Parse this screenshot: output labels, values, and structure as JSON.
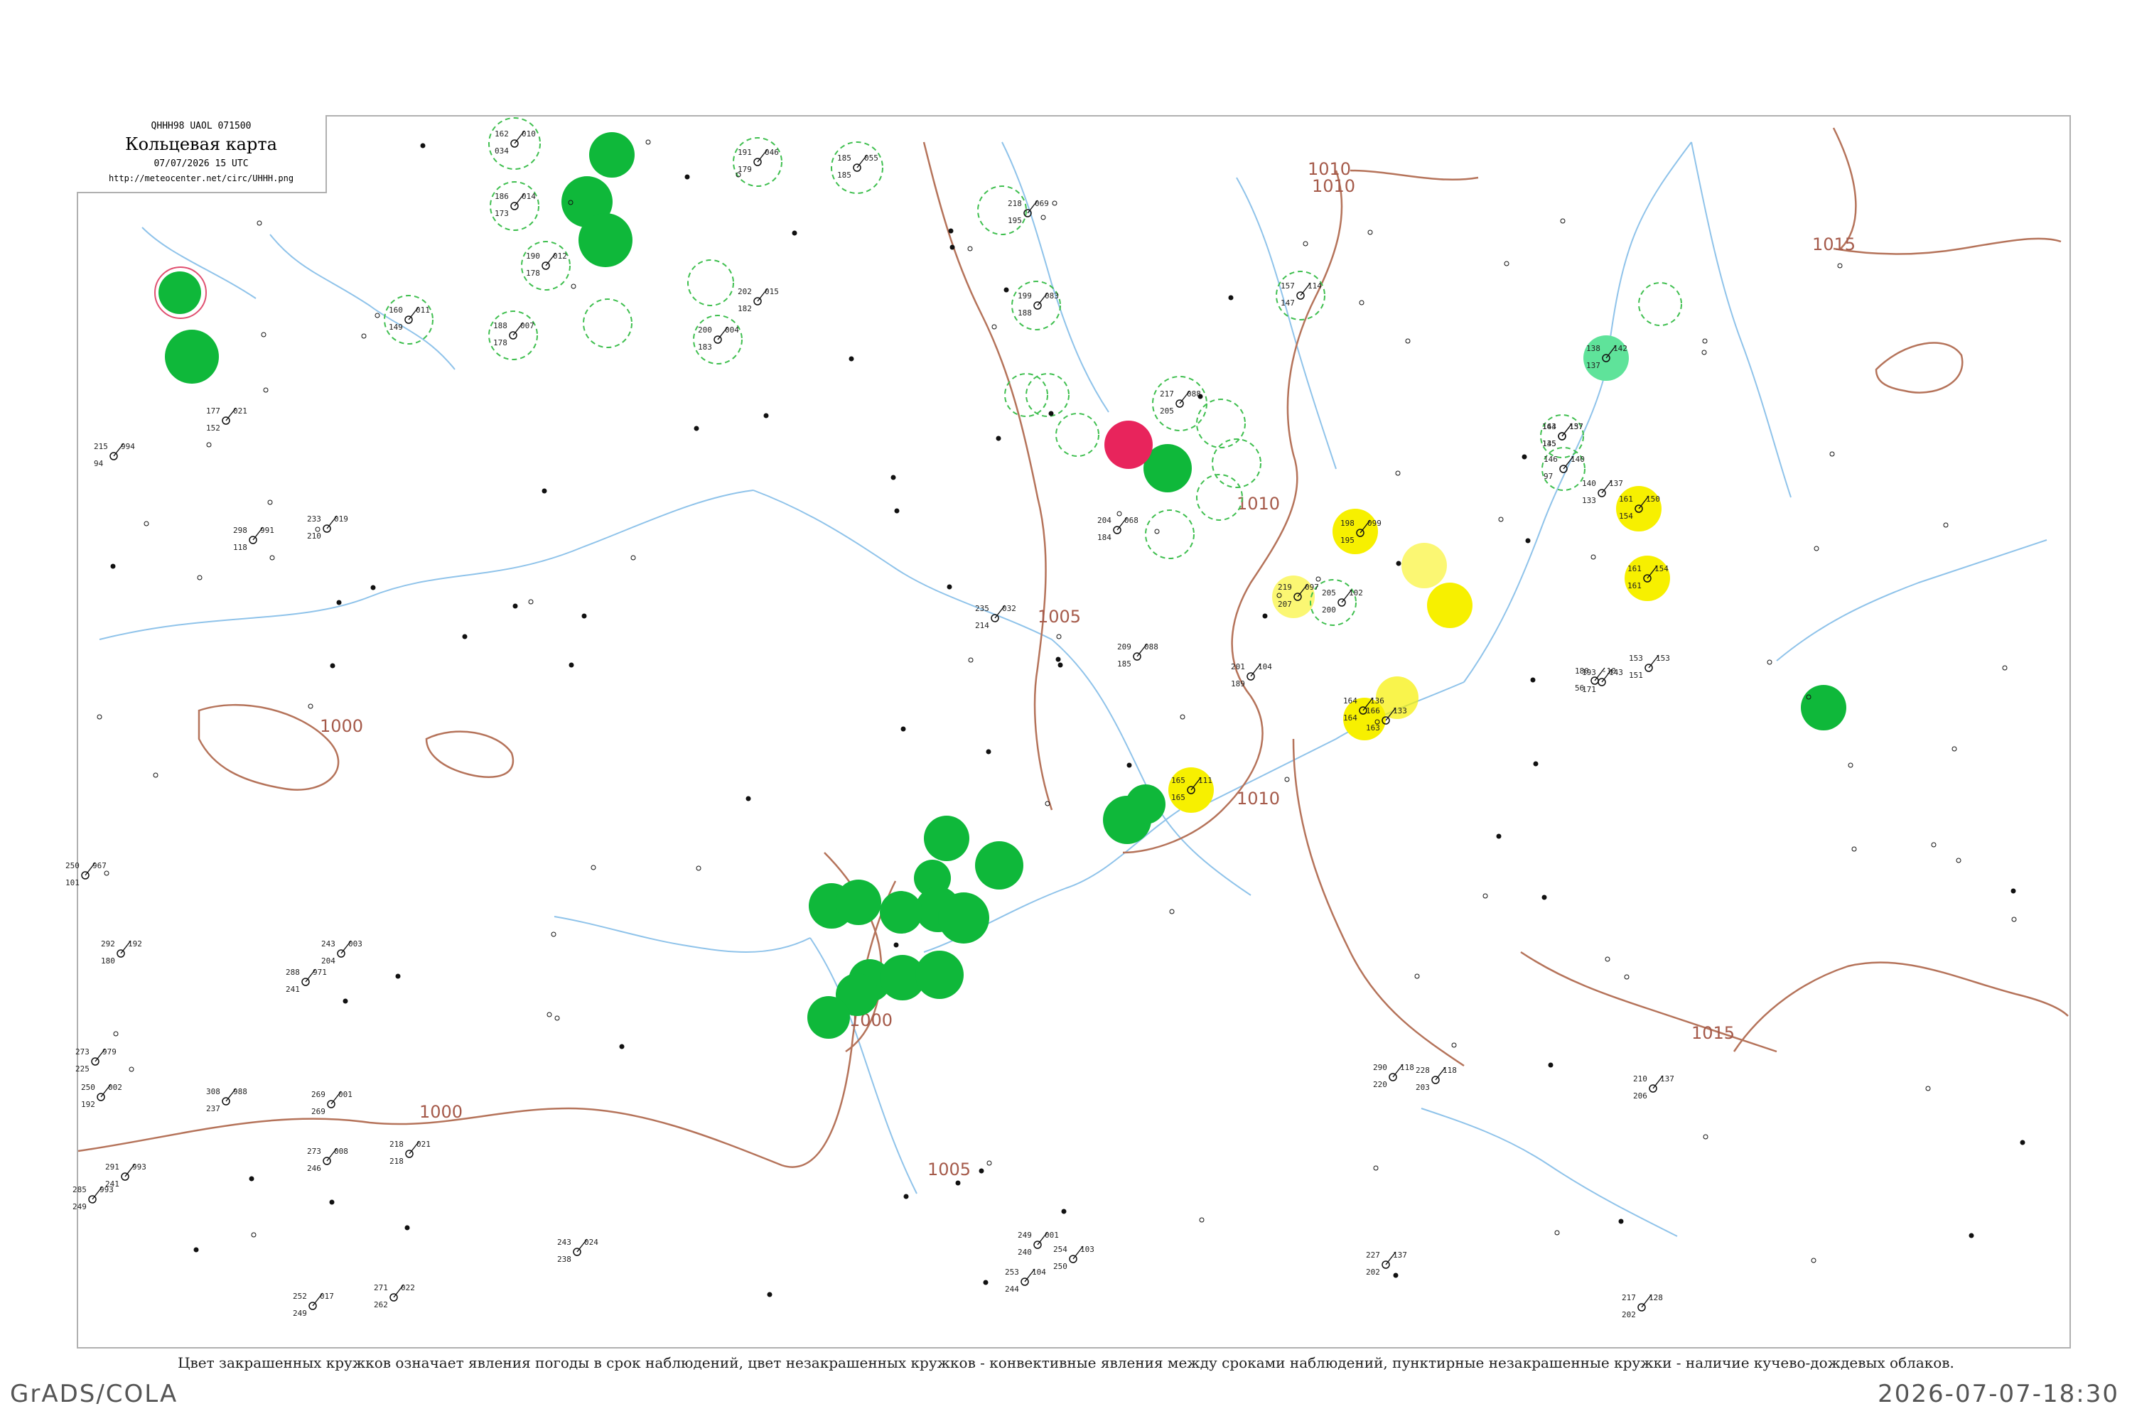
{
  "header": {
    "code": "QHHH98  UAOL  071500",
    "title": "Кольцевая карта",
    "date": "07/07/2026 15 UTC",
    "url": "http://meteocenter.net/circ/UHHH.png"
  },
  "caption": "Цвет закрашенных кружков означает явления погоды в срок наблюдений, цвет незакрашенных кружков - конвективные явления между сроками наблюдений, пунктирные незакрашенные кружки - наличие кучево-дождевых облаков.",
  "footer": {
    "left": "GrADS/COLA",
    "right": "2026-07-07-18:30"
  },
  "isobars": [
    "1000",
    "1005",
    "1010",
    "1015"
  ],
  "colors": {
    "isobar": "#b5735a",
    "river": "#8fc3ea",
    "green": "#0fb83a",
    "yellow": "#f7f000",
    "red": "#e8245c",
    "teal": "#5fe39a",
    "dashed_circle": "#3fbf4f"
  },
  "stations": [
    {
      "t": "191",
      "d": "179",
      "p": "046"
    },
    {
      "t": "185",
      "d": "185",
      "p": "055"
    },
    {
      "t": "162",
      "d": "034",
      "p": "010"
    },
    {
      "t": "186",
      "d": "173",
      "p": "014"
    },
    {
      "t": "160",
      "d": "149",
      "p": "011"
    },
    {
      "t": "190",
      "d": "178",
      "p": "012"
    },
    {
      "t": "188",
      "d": "178",
      "p": "007"
    },
    {
      "t": "200",
      "d": "183",
      "p": "004"
    },
    {
      "t": "202",
      "d": "182",
      "p": "015"
    },
    {
      "t": "218",
      "d": "195",
      "p": "069"
    },
    {
      "t": "199",
      "d": "188",
      "p": "083"
    },
    {
      "t": "217",
      "d": "205",
      "p": "088"
    },
    {
      "t": "157",
      "d": "147",
      "p": "114"
    },
    {
      "t": "140",
      "d": "133",
      "p": "137"
    },
    {
      "t": "146",
      "d": "97",
      "p": "140"
    },
    {
      "t": "166",
      "d": "163",
      "p": "133"
    },
    {
      "t": "164",
      "d": "164",
      "p": "136"
    },
    {
      "t": "198",
      "d": "195",
      "p": "099"
    },
    {
      "t": "219",
      "d": "207",
      "p": "097"
    },
    {
      "t": "205",
      "d": "200",
      "p": "102"
    },
    {
      "t": "144",
      "d": "135",
      "p": "157"
    },
    {
      "t": "161",
      "d": "154",
      "p": "150"
    },
    {
      "t": "161",
      "d": "161",
      "p": "154"
    },
    {
      "t": "138",
      "d": "137",
      "p": "142"
    },
    {
      "t": "163",
      "d": "145",
      "p": "137"
    },
    {
      "t": "165",
      "d": "165",
      "p": "111"
    },
    {
      "t": "177",
      "d": "152",
      "p": "021"
    },
    {
      "t": "215",
      "d": "94",
      "p": "994"
    },
    {
      "t": "298",
      "d": "118",
      "p": "991"
    },
    {
      "t": "233",
      "d": "210",
      "p": "019"
    },
    {
      "t": "204",
      "d": "184",
      "p": "068"
    },
    {
      "t": "235",
      "d": "214",
      "p": "032"
    },
    {
      "t": "209",
      "d": "185",
      "p": "088"
    },
    {
      "t": "201",
      "d": "189",
      "p": "104"
    },
    {
      "t": "180",
      "d": "56",
      "p": "-10"
    },
    {
      "t": "193",
      "d": "171",
      "p": "143"
    },
    {
      "t": "153",
      "d": "151",
      "p": "153"
    },
    {
      "t": "250",
      "d": "101",
      "p": "967"
    },
    {
      "t": "292",
      "d": "180",
      "p": "192"
    },
    {
      "t": "288",
      "d": "241",
      "p": "971"
    },
    {
      "t": "243",
      "d": "204",
      "p": "003"
    },
    {
      "t": "273",
      "d": "225",
      "p": "979"
    },
    {
      "t": "250",
      "d": "192",
      "p": "002"
    },
    {
      "t": "308",
      "d": "237",
      "p": "988"
    },
    {
      "t": "269",
      "d": "269",
      "p": "001"
    },
    {
      "t": "273",
      "d": "246",
      "p": "008"
    },
    {
      "t": "218",
      "d": "218",
      "p": "021"
    },
    {
      "t": "291",
      "d": "241",
      "p": "993"
    },
    {
      "t": "285",
      "d": "249",
      "p": "993"
    },
    {
      "t": "252",
      "d": "249",
      "p": "017"
    },
    {
      "t": "271",
      "d": "262",
      "p": "022"
    },
    {
      "t": "243",
      "d": "238",
      "p": "024"
    },
    {
      "t": "249",
      "d": "240",
      "p": "001"
    },
    {
      "t": "253",
      "d": "244",
      "p": "104"
    },
    {
      "t": "254",
      "d": "250",
      "p": "103"
    },
    {
      "t": "290",
      "d": "220",
      "p": "118"
    },
    {
      "t": "228",
      "d": "203",
      "p": "118"
    },
    {
      "t": "217",
      "d": "202",
      "p": "128"
    },
    {
      "t": "210",
      "d": "206",
      "p": "137"
    },
    {
      "t": "227",
      "d": "202",
      "p": "137"
    }
  ],
  "map_labels": [
    "Кольцевая карта"
  ]
}
